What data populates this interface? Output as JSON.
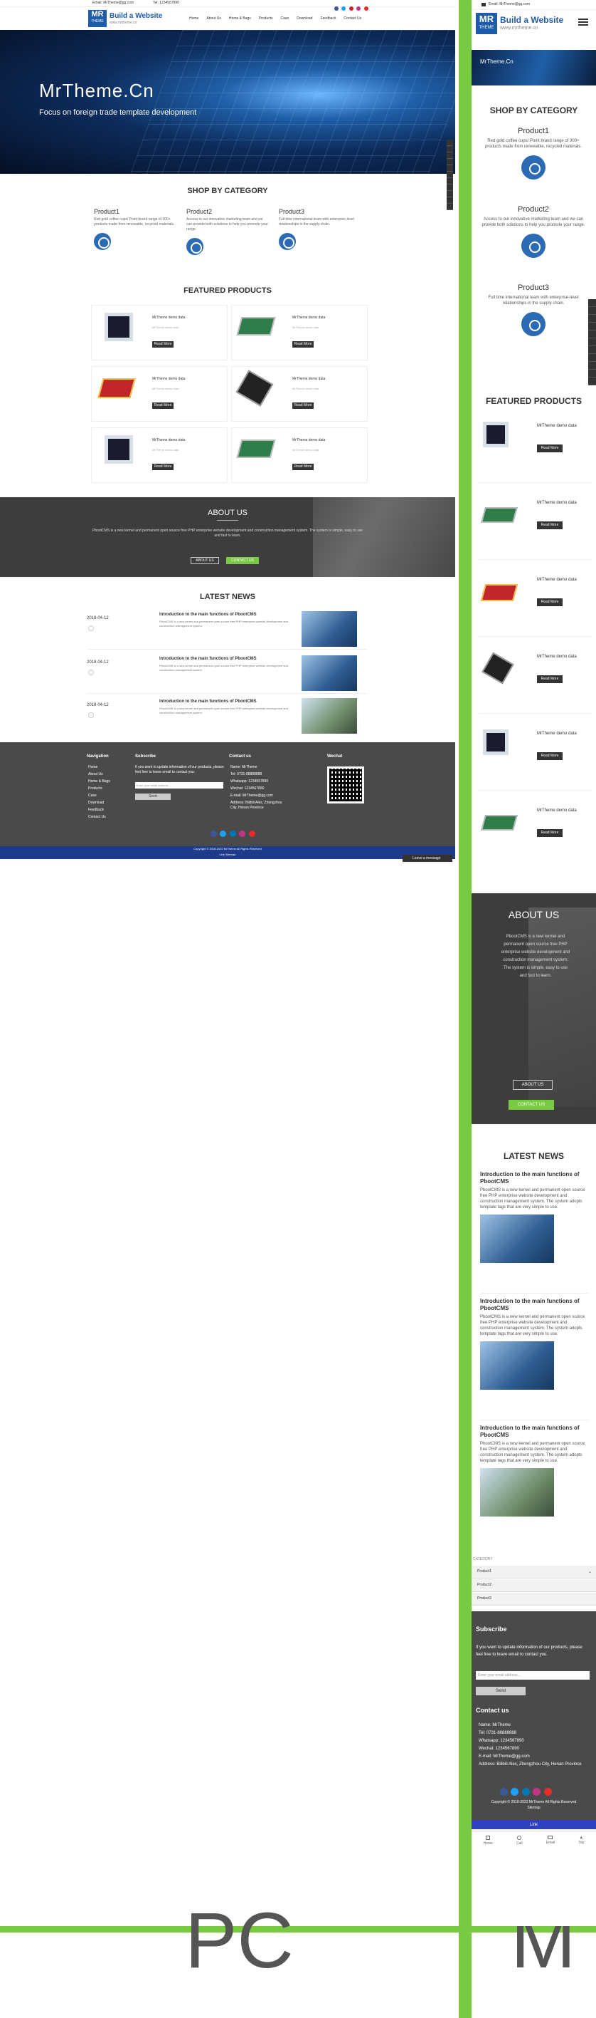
{
  "pc": {
    "topbar": {
      "email": "Email: MrTheme@gg.com",
      "tel": "Tel: 1234567890"
    },
    "logo": {
      "mark_top": "MR",
      "mark_bottom": "THEME",
      "title": "Build a Website",
      "subtitle": "www.mrtheme.cn"
    },
    "nav": [
      "Home",
      "About Us",
      "Home & Bags",
      "Products",
      "Case",
      "Download",
      "Feedback",
      "Contact Us"
    ],
    "hero": {
      "title": "MrTheme.Cn",
      "subtitle": "Focus on foreign trade template development"
    },
    "category": {
      "heading": "SHOP BY CATEGORY",
      "items": [
        {
          "name": "Product1",
          "desc": "Red gold coffee cups/ Point brand range of 300+ products made from renewable, recycled materials."
        },
        {
          "name": "Product2",
          "desc": "Access to our innovative marketing team and we can provide both solutions to help you promote your range."
        },
        {
          "name": "Product3",
          "desc": "Full time international team with enterprise-level relationships in the supply chain."
        }
      ]
    },
    "featured": {
      "heading": "FEATURED PRODUCTS",
      "items": [
        {
          "name": "MrTheme demo data",
          "sub": "MrTheme demo data",
          "btn": "Read More"
        },
        {
          "name": "MrTheme demo data",
          "sub": "MrTheme demo data",
          "btn": "Read More"
        },
        {
          "name": "MrTheme demo data",
          "sub": "MrTheme demo data",
          "btn": "Read More"
        },
        {
          "name": "MrTheme demo data",
          "sub": "MrTheme demo data",
          "btn": "Read More"
        },
        {
          "name": "MrTheme demo data",
          "sub": "MrTheme demo data",
          "btn": "Read More"
        },
        {
          "name": "MrTheme demo data",
          "sub": "MrTheme demo data",
          "btn": "Read More"
        }
      ]
    },
    "about": {
      "heading": "ABOUT US",
      "text": "PbootCMS is a new kernel and permanent open source free PHP enterprise website development and construction management system. The system is simple, easy to use and fast to learn.",
      "btn1": "ABOUT US",
      "btn2": "CONTACT US"
    },
    "news": {
      "heading": "LATEST NEWS",
      "items": [
        {
          "date": "2018-04-12",
          "title": "Introduction to the main functions of PbootCMS",
          "desc": "PbootCMS is a new kernel and permanent open source free PHP enterprise website development and construction management system."
        },
        {
          "date": "2018-04-12",
          "title": "Introduction to the main functions of PbootCMS",
          "desc": "PbootCMS is a new kernel and permanent open source free PHP enterprise website development and construction management system."
        },
        {
          "date": "2018-04-12",
          "title": "Introduction to the main functions of PbootCMS",
          "desc": "PbootCMS is a new kernel and permanent open source free PHP enterprise website development and construction management system."
        }
      ]
    },
    "footer": {
      "nav_title": "Navigation",
      "nav": [
        "Home",
        "About Us",
        "Home & Bags",
        "Products",
        "Case",
        "Download",
        "Feedback",
        "Contact Us"
      ],
      "sub_title": "Subscribe",
      "sub_text": "If you want to update information of our products, please feel free to leave email to contact you.",
      "sub_placeholder": "Enter your email address...",
      "sub_btn": "Send",
      "contact_title": "Contact us",
      "contact": [
        "Name: MrTheme",
        "Tel: 0731-88888888",
        "Whatsapp: 1234567890",
        "Wechat: 1234567890",
        "E-mail: MrTheme@gg.com",
        "Address: Bilibili Alex, Zhengzhou City, Henan Province"
      ],
      "wechat_title": "Wechat",
      "copyright": "Copyright © 2018-2022 MrTheme All Rights Reserved",
      "links": "Link  Sitemap"
    },
    "chat": "Leave a message"
  },
  "mobile": {
    "topbar": {
      "email": "Email: MrTheme@gg.com"
    },
    "logo": {
      "mark_top": "MR",
      "mark_bottom": "THEME",
      "title": "Build a Website",
      "subtitle": "www.mrtheme.cn"
    },
    "hero": {
      "title": "MrTheme.Cn"
    },
    "category": {
      "heading": "SHOP BY CATEGORY",
      "items": [
        {
          "name": "Product1",
          "desc": "Red gold coffee cups/ Point brand range of 300+ products made from renewable, recycled materials."
        },
        {
          "name": "Product2",
          "desc": "Access to our innovative marketing team and we can provide both solutions to help you promote your range."
        },
        {
          "name": "Product3",
          "desc": "Full time international team with enterprise-level relationships in the supply chain."
        }
      ]
    },
    "featured": {
      "heading": "FEATURED PRODUCTS",
      "items": [
        {
          "name": "MrTheme demo data",
          "btn": "Read More"
        },
        {
          "name": "MrTheme demo data",
          "btn": "Read More"
        },
        {
          "name": "MrTheme demo data",
          "btn": "Read More"
        },
        {
          "name": "MrTheme demo data",
          "btn": "Read More"
        },
        {
          "name": "MrTheme demo data",
          "btn": "Read More"
        },
        {
          "name": "MrTheme demo data",
          "btn": "Read More"
        }
      ]
    },
    "about": {
      "heading": "ABOUT US",
      "text": "PbootCMS is a new kernel and permanent open source free PHP enterprise website development and construction management system. The system is simple, easy to use and fast to learn.",
      "btn1": "ABOUT US",
      "btn2": "CONTACT US"
    },
    "news": {
      "heading": "LATEST NEWS",
      "items": [
        {
          "title": "Introduction to the main functions of PbootCMS",
          "desc": "PbootCMS is a new kernel and permanent open source free PHP enterprise website development and construction management system. The system adopts template tags that are very simple to use."
        },
        {
          "title": "Introduction to the main functions of PbootCMS",
          "desc": "PbootCMS is a new kernel and permanent open source free PHP enterprise website development and construction management system. The system adopts template tags that are very simple to use."
        },
        {
          "title": "Introduction to the main functions of PbootCMS",
          "desc": "PbootCMS is a new kernel and permanent open source free PHP enterprise website development and construction management system. The system adopts template tags that are very simple to use."
        }
      ]
    },
    "categories_label": "CATEGORY",
    "categories": [
      "Product1",
      "Product2",
      "Product3"
    ],
    "footer": {
      "sub_title": "Subscribe",
      "sub_text": "If you want to update information of our products, please feel free to leave email to contact you.",
      "sub_placeholder": "Enter your email address...",
      "sub_btn": "Send",
      "contact_title": "Contact us",
      "contact": [
        "Name: MrTheme",
        "Tel: 0731-88888888",
        "Whatsapp: 1234567890",
        "Wechat: 1234567890",
        "E-mail: MrTheme@gg.com",
        "Address: Bilibili Alex, Zhengzhou City, Henan Province"
      ],
      "copyright": "Copyright © 2018-2022 MrTheme All Rights Reserved   Sitemap",
      "link": "Link"
    },
    "bottom_nav": [
      "Home",
      "Call",
      "Email",
      "Top"
    ]
  },
  "labels": {
    "pc": "PC",
    "m": "M"
  },
  "colors": {
    "brand_blue": "#1e5ba8",
    "green": "#7ac943",
    "footer_dark": "#4a4a4a",
    "about_dark": "#3d3d3d"
  }
}
